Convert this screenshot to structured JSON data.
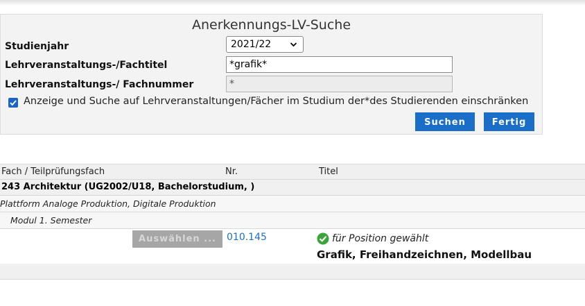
{
  "search": {
    "title": "Anerkennungs-LV-Suche",
    "study_year_label": "Studienjahr",
    "study_year_value": "2021/22",
    "course_title_label": "Lehrveranstaltungs-/Fachtitel",
    "course_title_value": "*grafik*",
    "course_number_label": "Lehrveranstaltungs-/ Fachnummer",
    "course_number_value": "*",
    "restrict_checkbox_label": "Anzeige und Suche auf Lehrveranstaltungen/Fächer im Studium der*des Studierenden einschränken",
    "restrict_checked": true,
    "search_button": "Suchen",
    "done_button": "Fertig"
  },
  "results": {
    "columns": [
      "Fach / Teilprüfungsfach",
      "Nr.",
      "Titel"
    ],
    "group": "243 Architektur (UG2002/U18, Bachelorstudium, )",
    "subgroup": "Plattform Analoge Produktion, Digitale Produktion",
    "module": "Modul 1. Semester",
    "entry": {
      "select_button": "Auswählen ...",
      "number": "010.145",
      "status": "für Position gewählt",
      "title": "Grafik, Freihandzeichnen, Modellbau"
    }
  },
  "colors": {
    "button_blue": "#1a6ec8",
    "link_blue": "#1a70c0",
    "status_green": "#3aa33a"
  },
  "icons": {
    "checkbox": "checkbox-checked-icon",
    "status": "green-check-icon",
    "select_chevron": "chevron-down-icon"
  }
}
